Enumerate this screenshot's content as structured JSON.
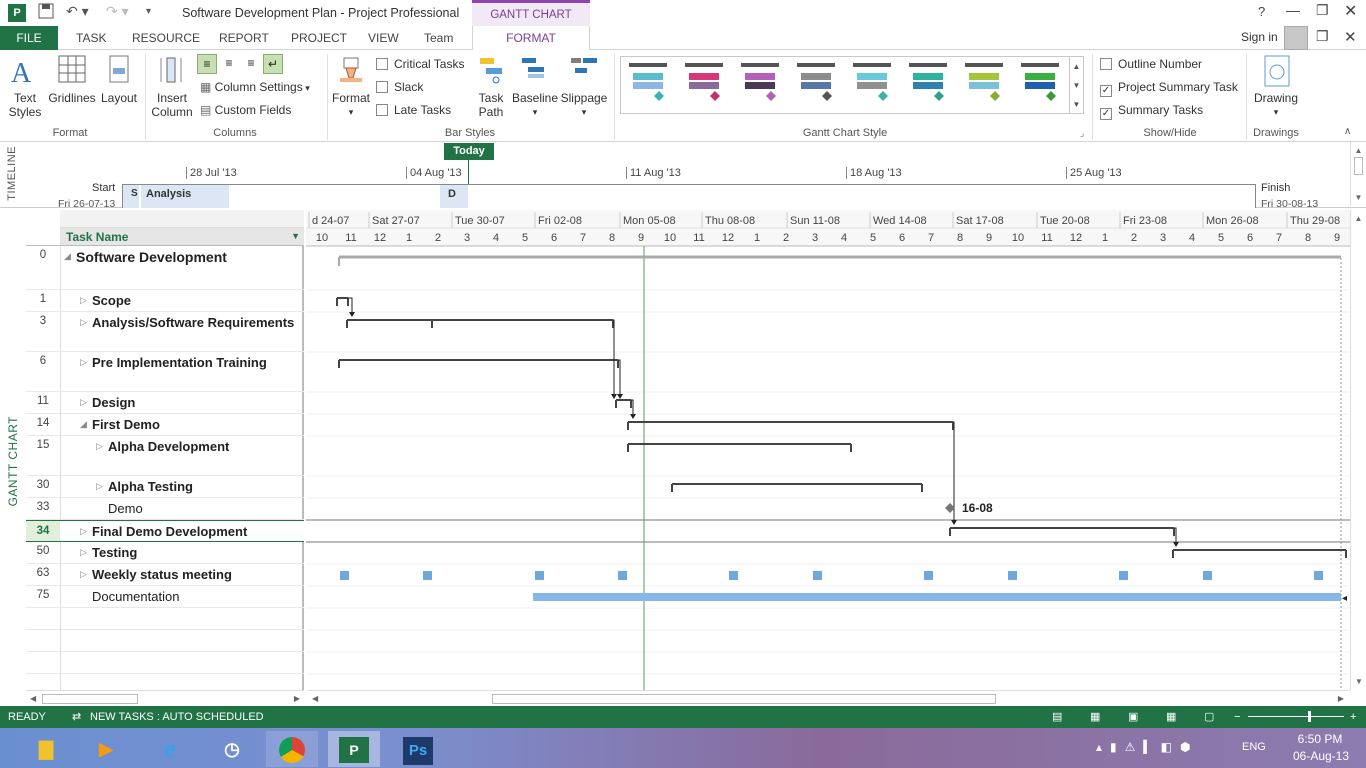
{
  "app": {
    "title": "Software Development Plan - Project Professional",
    "context_tab_title": "GANTT CHART TOOLS",
    "help": "?",
    "sign_in": "Sign in"
  },
  "tabs": [
    "FILE",
    "TASK",
    "RESOURCE",
    "REPORT",
    "PROJECT",
    "VIEW",
    "Team",
    "FORMAT"
  ],
  "ribbon": {
    "format_group": {
      "label": "Format",
      "text_styles": "Text Styles",
      "gridlines": "Gridlines",
      "layout": "Layout"
    },
    "columns_group": {
      "label": "Columns",
      "insert_column": "Insert Column",
      "column_settings": "Column Settings",
      "custom_fields": "Custom Fields"
    },
    "bar_styles_group": {
      "label": "Bar Styles",
      "format": "Format",
      "critical_tasks": "Critical Tasks",
      "slack": "Slack",
      "late_tasks": "Late Tasks",
      "task_path": "Task Path",
      "baseline": "Baseline",
      "slippage": "Slippage"
    },
    "gantt_style_group": {
      "label": "Gantt Chart Style",
      "swatches": [
        {
          "top": "#5bbccd",
          "bottom": "#8eb7e6",
          "diamond": "#3bb3b3"
        },
        {
          "top": "#d6377a",
          "bottom": "#8b6a9a",
          "diamond": "#c0306a"
        },
        {
          "top": "#b460b8",
          "bottom": "#4a3a55",
          "diamond": "#b460b8"
        },
        {
          "top": "#8d8d8d",
          "bottom": "#5678a8",
          "diamond": "#555555"
        },
        {
          "top": "#6ac9d8",
          "bottom": "#909090",
          "diamond": "#3bb3a8"
        },
        {
          "top": "#2fb3a0",
          "bottom": "#2f7fb0",
          "diamond": "#2fa090"
        },
        {
          "top": "#a8c43a",
          "bottom": "#7ac2d8",
          "diamond": "#8aaa30"
        },
        {
          "top": "#3ab040",
          "bottom": "#1f5fb0",
          "diamond": "#3a9a3a"
        }
      ]
    },
    "show_hide_group": {
      "label": "Show/Hide",
      "outline_number": "Outline Number",
      "project_summary_task": "Project Summary Task",
      "summary_tasks": "Summary Tasks",
      "outline_checked": false,
      "project_summary_checked": true,
      "summary_checked": true
    },
    "drawings_group": {
      "label": "Drawings",
      "drawing": "Drawing"
    }
  },
  "timeline": {
    "side_label": "TIMELINE",
    "today": "Today",
    "dates": [
      "28 Jul '13",
      "04 Aug '13",
      "11 Aug '13",
      "18 Aug '13",
      "25 Aug '13"
    ],
    "start_label": "Start",
    "start_date": "Fri 26-07-13",
    "finish_label": "Finish",
    "finish_date": "Fri 30-08-13",
    "analysis": "Analysis",
    "seg_s": "S",
    "seg_d": "D"
  },
  "gantt": {
    "side_label": "GANTT CHART",
    "column_header": "Task Name",
    "top_scale": [
      "d 24-07",
      "Sat 27-07",
      "Tue 30-07",
      "Fri 02-08",
      "Mon 05-08",
      "Thu 08-08",
      "Sun 11-08",
      "Wed 14-08",
      "Sat 17-08",
      "Tue 20-08",
      "Fri 23-08",
      "Mon 26-08",
      "Thu 29-08"
    ],
    "bottom_scale": [
      "10",
      "11",
      "12",
      "1",
      "2",
      "3",
      "4",
      "5",
      "6",
      "7",
      "8",
      "9",
      "10",
      "11",
      "12",
      "1",
      "2",
      "3",
      "4",
      "5",
      "6",
      "7",
      "8",
      "9",
      "10",
      "11",
      "12",
      "1",
      "2",
      "3",
      "4",
      "5",
      "6",
      "7",
      "8",
      "9"
    ],
    "milestone_label": "16-08",
    "rows": [
      {
        "id": "0",
        "name": "Software Development"
      },
      {
        "id": "1",
        "name": "Scope"
      },
      {
        "id": "3",
        "name": "Analysis/Software Requirements"
      },
      {
        "id": "6",
        "name": "Pre Implementation Training"
      },
      {
        "id": "11",
        "name": "Design"
      },
      {
        "id": "14",
        "name": "First Demo"
      },
      {
        "id": "15",
        "name": "Alpha Development"
      },
      {
        "id": "30",
        "name": "Alpha Testing"
      },
      {
        "id": "33",
        "name": "Demo"
      },
      {
        "id": "34",
        "name": "Final Demo Development"
      },
      {
        "id": "50",
        "name": "Testing"
      },
      {
        "id": "63",
        "name": "Weekly status meeting"
      },
      {
        "id": "75",
        "name": "Documentation"
      }
    ]
  },
  "status": {
    "ready": "READY",
    "new_tasks": "NEW TASKS : AUTO SCHEDULED"
  },
  "taskbar": {
    "lang": "ENG",
    "time": "6:50 PM",
    "date": "06-Aug-13"
  }
}
